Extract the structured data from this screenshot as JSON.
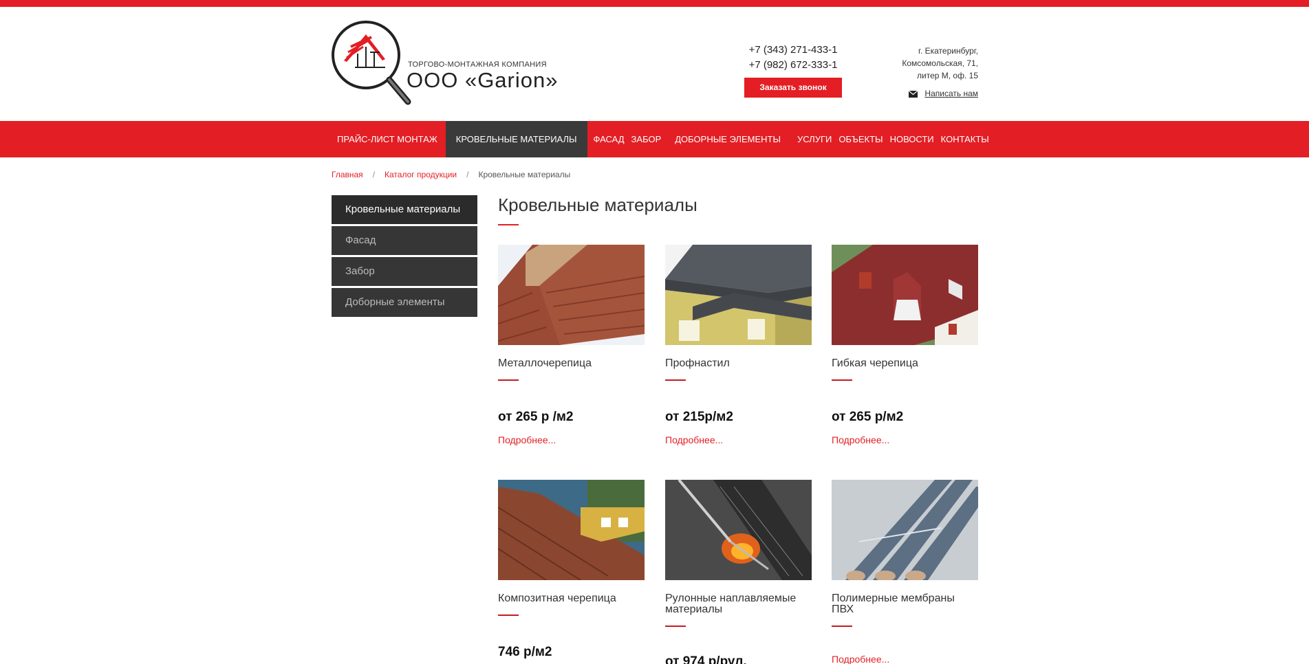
{
  "header": {
    "company_sub": "ТОРГОВО-МОНТАЖНАЯ КОМПАНИЯ",
    "company_name": "ООО «Garion»",
    "phone1": "+7 (343) 271-433-1",
    "phone2": "+7 (982) 672-333-1",
    "call_button": "Заказать звонок",
    "address1": "г. Екатеринбург,",
    "address2": "Комсомольская, 71,",
    "address3": "литер М, оф. 15",
    "write_us": "Написать нам"
  },
  "nav": {
    "items": [
      {
        "label": "ПРАЙС-ЛИСТ МОНТАЖ"
      },
      {
        "label": "КРОВЕЛЬНЫЕ МАТЕРИАЛЫ"
      },
      {
        "label": "ФАСАД"
      },
      {
        "label": "ЗАБОР"
      },
      {
        "label": "ДОБОРНЫЕ ЭЛЕМЕНТЫ"
      },
      {
        "label": "УСЛУГИ"
      },
      {
        "label": "ОБЪЕКТЫ"
      },
      {
        "label": "НОВОСТИ"
      },
      {
        "label": "КОНТАКТЫ"
      }
    ]
  },
  "breadcrumb": {
    "home": "Главная",
    "separator": "/",
    "catalog": "Каталог продукции",
    "current": "Кровельные материалы"
  },
  "sidebar": {
    "items": [
      {
        "label": "Кровельные материалы"
      },
      {
        "label": "Фасад"
      },
      {
        "label": "Забор"
      },
      {
        "label": "Доборные элементы"
      }
    ]
  },
  "main": {
    "title": "Кровельные материалы",
    "products": [
      {
        "name": "Металлочерепица",
        "price": "от 265 р /м2",
        "more": "Подробнее..."
      },
      {
        "name": "Профнастил",
        "price": " от 215р/м2",
        "more": "Подробнее..."
      },
      {
        "name": "Гибкая черепица",
        "price": " от 265 р/м2",
        "more": "Подробнее..."
      },
      {
        "name": "Композитная черепица",
        "price": "746 р/м2",
        "more": ""
      },
      {
        "name": "Рулонные наплавляемые материалы",
        "price": "от 974 р/рул.",
        "more": ""
      },
      {
        "name": "Полимерные мембраны ПВХ",
        "price": "",
        "more": "Подробнее..."
      }
    ]
  },
  "colors": {
    "brand_red": "#e31e24",
    "nav_active": "#3a3a3a",
    "sidebar_bg": "#363636"
  }
}
